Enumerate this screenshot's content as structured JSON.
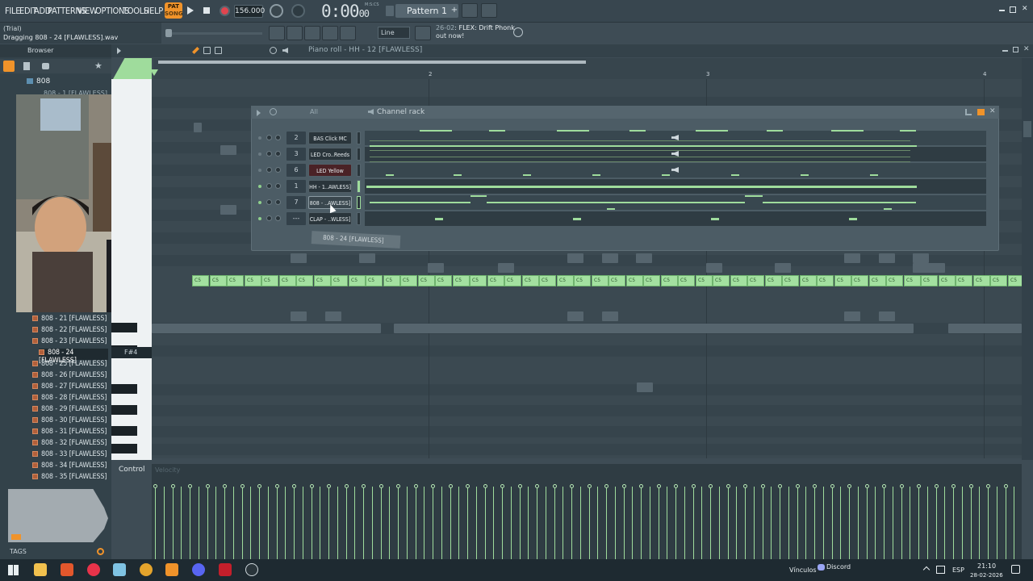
{
  "menu": [
    "FILE",
    "EDIT",
    "ADD",
    "PATTERNS",
    "VIEW",
    "OPTIONS",
    "TOOLS",
    "HELP"
  ],
  "hint": {
    "line1": "(Trial)",
    "line2": "Dragging 808 - 24 [FLAWLESS].wav"
  },
  "transport": {
    "pat": "PAT",
    "song": "SONG",
    "tempo": "156.000",
    "time": "0:00",
    "time_sub": "00",
    "time_label": "M:S:CS",
    "pattern": "Pattern 1"
  },
  "snap": "Line",
  "news": {
    "date": "26-02",
    "title": "FLEX: Drift Phonk",
    "sub": "out now!"
  },
  "browser": {
    "title": "Browser",
    "folder": "808",
    "peek": "808 - 1 [FLAWLESS]",
    "items": [
      "808 - 21 [FLAWLESS]",
      "808 - 22 [FLAWLESS]",
      "808 - 23 [FLAWLESS]",
      "808 - 24 [FLAWLESS]",
      "808 - 25 [FLAWLESS]",
      "808 - 26 [FLAWLESS]",
      "808 - 27 [FLAWLESS]",
      "808 - 28 [FLAWLESS]",
      "808 - 29 [FLAWLESS]",
      "808 - 30 [FLAWLESS]",
      "808 - 31 [FLAWLESS]",
      "808 - 32 [FLAWLESS]",
      "808 - 33 [FLAWLESS]",
      "808 - 34 [FLAWLESS]",
      "808 - 35 [FLAWLESS]"
    ],
    "tags": "TAGS"
  },
  "piano_roll": {
    "title": "Piano roll - HH - 12 [FLAWLESS]",
    "key_label": "F#4",
    "note_label": "C5",
    "bars": [
      "2",
      "3",
      "4"
    ],
    "control": "Control",
    "control_sub": "Velocity"
  },
  "channel_rack": {
    "title": "Channel rack",
    "filter": "All",
    "channels": [
      {
        "num": "2",
        "name": "BAS Click MC"
      },
      {
        "num": "3",
        "name": "LED Cro..Reeds"
      },
      {
        "num": "6",
        "name": "LED Yellow"
      },
      {
        "num": "1",
        "name": "HH - 1..AWLESS]"
      },
      {
        "num": "7",
        "name": "808 - ..AWLESS]"
      },
      {
        "num": "---",
        "name": "CLAP - ..WLESS]"
      }
    ],
    "drag_label": "808 - 24 [FLAWLESS]"
  },
  "taskbar": {
    "vinculos": "Vínculos",
    "discord": "Discord",
    "lang": "ESP",
    "time": "21:10",
    "date": "28-02-2026"
  }
}
